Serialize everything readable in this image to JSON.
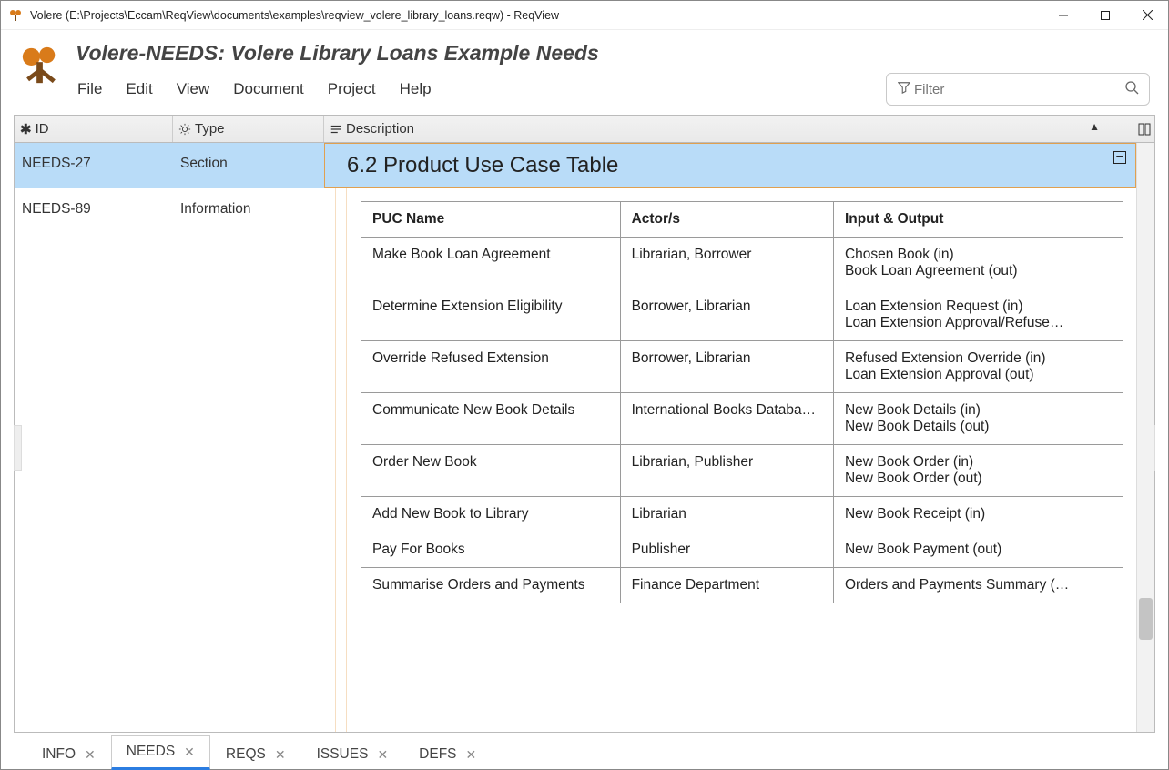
{
  "window": {
    "title": "Volere (E:\\Projects\\Eccam\\ReqView\\documents\\examples\\reqview_volere_library_loans.reqw) - ReqView"
  },
  "header": {
    "doc_title": "Volere-NEEDS: Volere Library Loans Example Needs",
    "menu": [
      "File",
      "Edit",
      "View",
      "Document",
      "Project",
      "Help"
    ],
    "search_placeholder": "Filter"
  },
  "columns": {
    "id": "ID",
    "type": "Type",
    "desc": "Description"
  },
  "rows": [
    {
      "id": "NEEDS-27",
      "type": "Section",
      "selected": true
    },
    {
      "id": "NEEDS-89",
      "type": "Information",
      "selected": false
    }
  ],
  "section_title": "6.2 Product Use Case Table",
  "table": {
    "headers": [
      "PUC Name",
      "Actor/s",
      "Input & Output"
    ],
    "rows": [
      {
        "c1": "Make Book Loan Agreement",
        "c2": "Librarian, Borrower",
        "c3a": "Chosen Book (in)",
        "c3b": "Book Loan Agreement (out)"
      },
      {
        "c1": "Determine Extension Eligibility",
        "c2": "Borrower, Librarian",
        "c3a": "Loan Extension Request (in)",
        "c3b": "Loan Extension Approval/Refuse…"
      },
      {
        "c1": "Override Refused Extension",
        "c2": "Borrower, Librarian",
        "c3a": "Refused Extension Override (in)",
        "c3b": "Loan Extension Approval (out)"
      },
      {
        "c1": "Communicate New Book Details",
        "c2": "International Books Databa…",
        "c3a": "New Book Details (in)",
        "c3b": "New Book Details (out)"
      },
      {
        "c1": "Order New Book",
        "c2": "Librarian, Publisher",
        "c3a": "New Book Order (in)",
        "c3b": "New Book Order (out)"
      },
      {
        "c1": "Add New Book to Library",
        "c2": "Librarian",
        "c3a": "New Book Receipt (in)",
        "c3b": ""
      },
      {
        "c1": "Pay For Books",
        "c2": "Publisher",
        "c3a": "New Book Payment (out)",
        "c3b": ""
      },
      {
        "c1": "Summarise Orders and Payments",
        "c2": "Finance Department",
        "c3a": "Orders and Payments Summary (…",
        "c3b": ""
      }
    ]
  },
  "tabs": [
    {
      "label": "INFO",
      "active": false
    },
    {
      "label": "NEEDS",
      "active": true
    },
    {
      "label": "REQS",
      "active": false
    },
    {
      "label": "ISSUES",
      "active": false
    },
    {
      "label": "DEFS",
      "active": false
    }
  ]
}
